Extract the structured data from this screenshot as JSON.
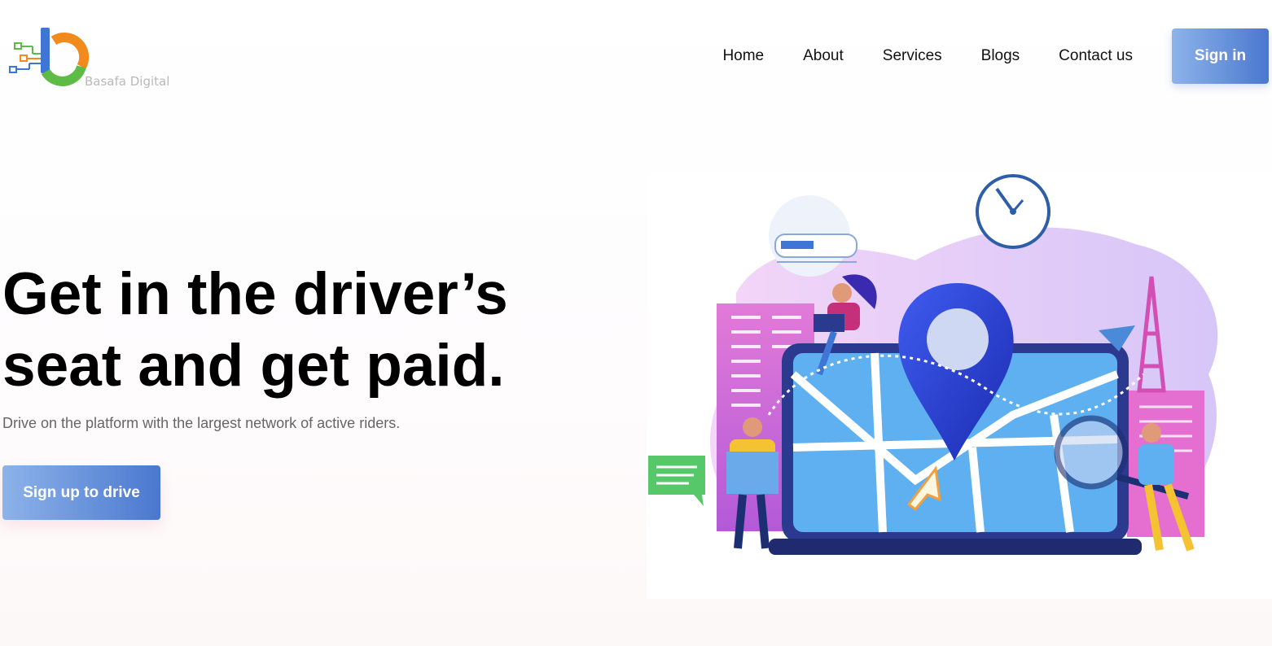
{
  "brand": {
    "name": "Basafa Digital",
    "logo_icon": "basafa-logo-icon"
  },
  "nav": {
    "links": [
      "Home",
      "About",
      "Services",
      "Blogs",
      "Contact us"
    ],
    "signin_label": "Sign in"
  },
  "hero": {
    "title": "Get in the driver’s seat and get paid.",
    "subtitle": "Drive on the platform with the largest network of active riders.",
    "cta_label": "Sign up to drive"
  },
  "colors": {
    "button_gradient_start": "#8db3ea",
    "button_gradient_end": "#4a78cf",
    "logo_orange": "#f28a1c",
    "logo_green": "#5dbb46",
    "logo_blue": "#3f76d6"
  }
}
